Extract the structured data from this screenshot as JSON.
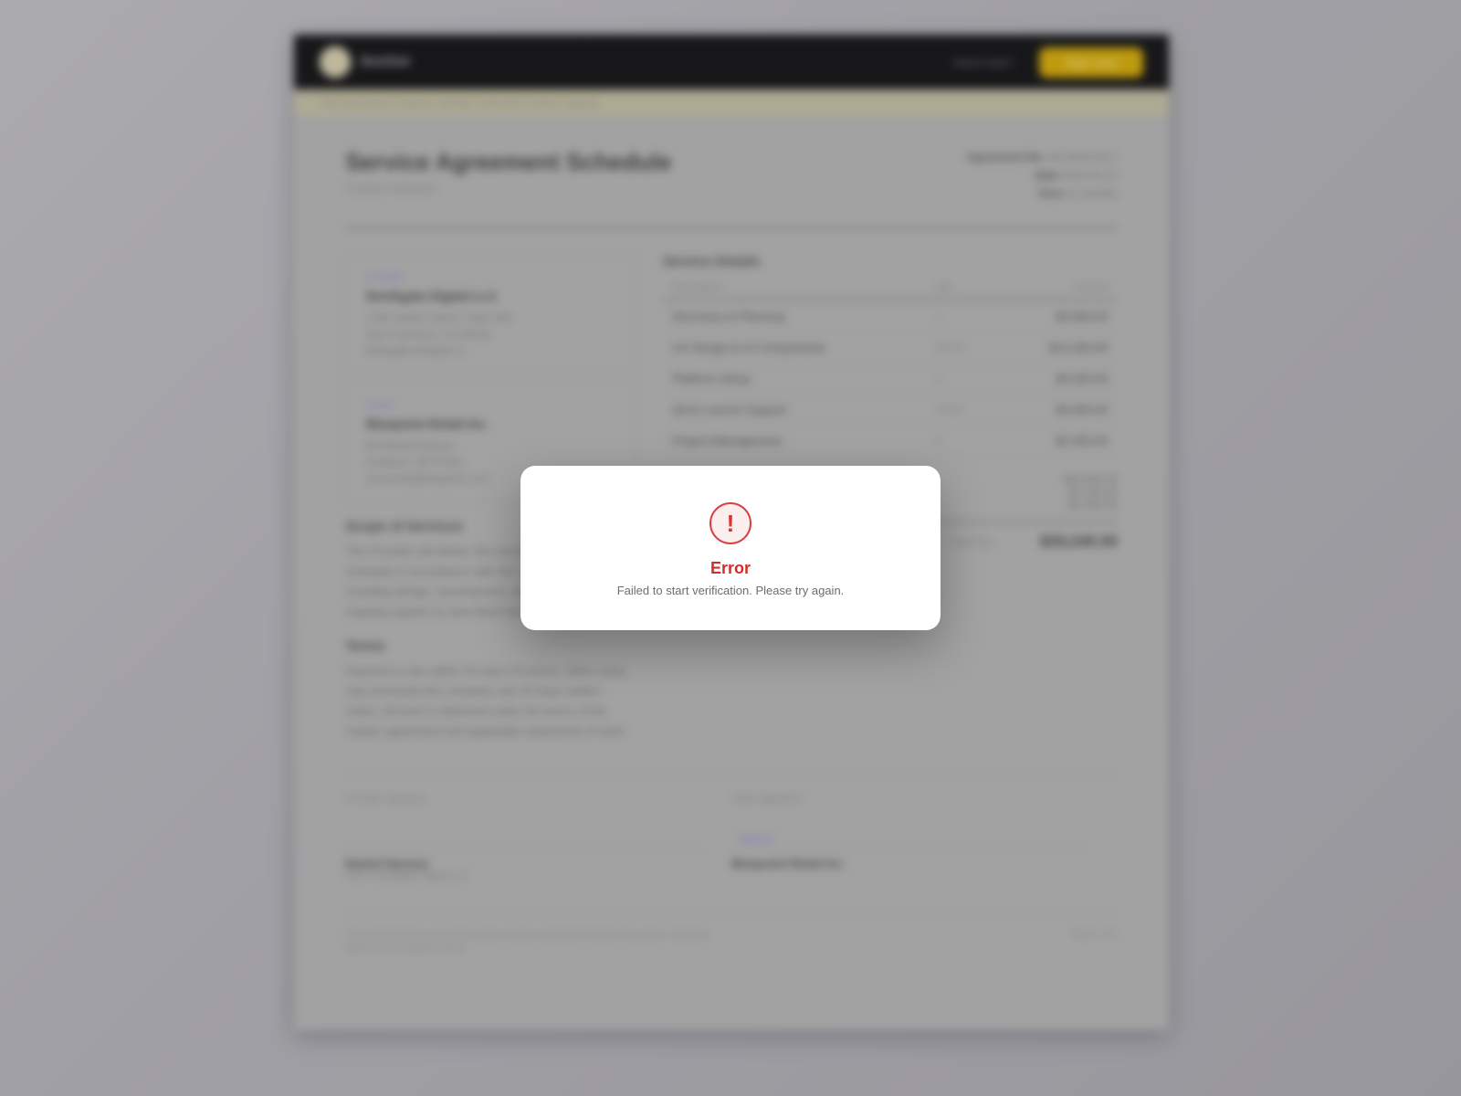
{
  "header": {
    "logo_text": "Anchor",
    "link_label": "Need help?",
    "cta_label": "Sign now"
  },
  "banner": {
    "text": "This document requires identity verification before signing"
  },
  "document": {
    "title": "Service Agreement Schedule",
    "subtitle": "Contract reference",
    "meta": {
      "agreement_label": "Agreement No.",
      "agreement_value": "SA-2024-0117",
      "date_label": "Date",
      "date_value": "2024-03-14",
      "term_label": "Term",
      "term_value": "12 months"
    },
    "parties": [
      {
        "role": "Provider",
        "name": "Northgate Digital LLC",
        "lines": [
          "1200 Harbor Street, Suite 400",
          "San Francisco, CA 94105",
          "billing@northgate.io"
        ]
      },
      {
        "role": "Client",
        "name": "Bluepoint Retail Inc.",
        "lines": [
          "88 Market Avenue",
          "Portland, OR 97204",
          "accounts@bluepoint.com"
        ]
      }
    ],
    "scope_heading": "Scope of Services",
    "scope_text": "The Provider will deliver the services listed in this schedule in accordance with the master agreement, including design, development, deployment and ongoing support as described herein.",
    "terms_heading": "Terms",
    "terms_text": "Payment is due within 30 days of invoice. Either party may terminate this schedule with 30 days written notice. All work is delivered under the terms of the master agreement and applicable statements of work.",
    "items_heading": "Service Details",
    "items_columns": [
      "Description",
      "Qty",
      "Amount"
    ],
    "items": [
      {
        "desc": "Discovery & Planning",
        "qty": "1",
        "amount": "$4,800.00"
      },
      {
        "desc": "UX Design & UI Components",
        "qty": "80 hrs",
        "amount": "$12,000.00"
      },
      {
        "desc": "Platform Setup",
        "qty": "1",
        "amount": "$3,200.00"
      },
      {
        "desc": "QA & Launch Support",
        "qty": "40 hrs",
        "amount": "$5,600.00"
      },
      {
        "desc": "Project Management",
        "qty": "1",
        "amount": "$2,400.00"
      }
    ],
    "totals": {
      "subtotal": "$28,000.00",
      "tax": "$2,240.00",
      "discount": "-$1,000.00",
      "total_label": "Total Due",
      "total_value": "$29,240.00"
    },
    "signatures": [
      {
        "label": "Provider signature",
        "mark": "",
        "name": "Daniel Harmon",
        "title": "CEO, Northgate Digital LLC"
      },
      {
        "label": "Client signature",
        "mark": "Signed",
        "name": "Bluepoint Retail Inc.",
        "title": ""
      }
    ],
    "footer_text": "This schedule forms part of the master services agreement between the parties. Electronic signatures are legally binding.",
    "footer_page": "Page 1 of 1"
  },
  "modal": {
    "icon": "exclamation-icon",
    "icon_glyph": "!",
    "title": "Error",
    "message": "Failed to start verification. Please try again."
  }
}
